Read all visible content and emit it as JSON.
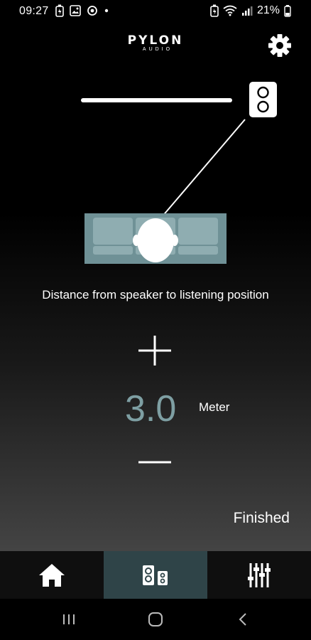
{
  "status_bar": {
    "time": "09:27",
    "battery_percent": "21%",
    "left_icons": [
      "battery-saver-icon",
      "gallery-icon",
      "sync-icon",
      "dot-icon"
    ],
    "right_icons": [
      "battery-saver-icon",
      "wifi-icon",
      "signal-icon",
      "battery-icon"
    ]
  },
  "header": {
    "brand": "PYLON",
    "brand_sub": "AUDIO",
    "settings_icon": "gear-icon"
  },
  "setup": {
    "instruction": "Distance from speaker to listening position",
    "distance_value": "3.0",
    "unit": "Meter",
    "increase_icon": "plus-icon",
    "decrease_icon": "minus-icon",
    "finished_label": "Finished"
  },
  "tabs": [
    {
      "name": "home",
      "icon": "home-icon",
      "active": false
    },
    {
      "name": "speakers",
      "icon": "speakers-icon",
      "active": true
    },
    {
      "name": "equalizer",
      "icon": "equalizer-icon",
      "active": false
    }
  ],
  "colors": {
    "accent": "#7e9fa3",
    "sofa": "#6f9196",
    "active_tab": "#2f4448"
  }
}
